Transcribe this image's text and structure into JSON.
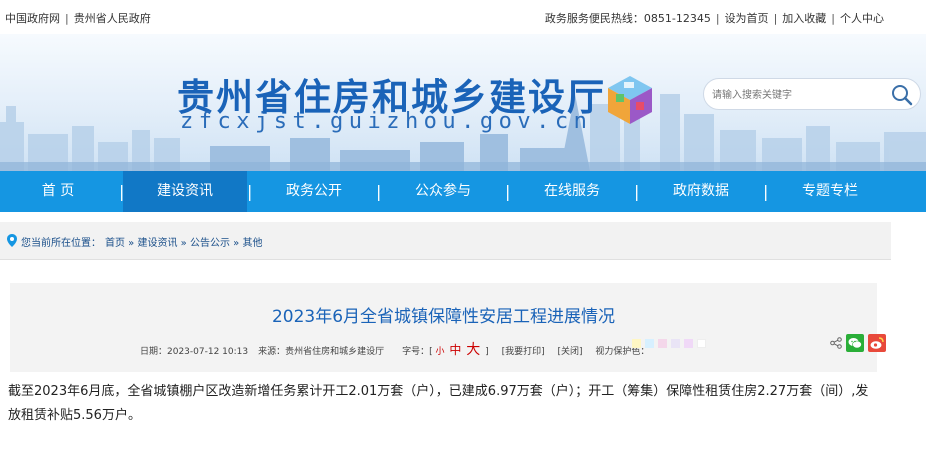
{
  "topbar": {
    "left_links": [
      "中国政府网",
      "贵州省人民政府"
    ],
    "right_items": [
      "政务服务便民热线：0851-12345",
      "设为首页",
      "加入收藏",
      "个人中心"
    ]
  },
  "header": {
    "title": "贵州省住房和城乡建设厅",
    "domain": "zfcxjst.guizhou.gov.cn",
    "search_placeholder": "请输入搜索关键字"
  },
  "nav": {
    "items": [
      "首 页",
      "建设资讯",
      "政务公开",
      "公众参与",
      "在线服务",
      "政府数据",
      "专题专栏"
    ],
    "active_index": 1
  },
  "breadcrumb": {
    "label": "您当前所在位置：",
    "path": [
      "首页",
      "建设资讯",
      "公告公示",
      "其他"
    ]
  },
  "article": {
    "title": "2023年6月全省城镇保障性安居工程进展情况",
    "date": "日期：2023-07-12 10:13",
    "source": "来源：贵州省住房和城乡建设厅",
    "font_size_label": "字号：[",
    "font_small": "小",
    "font_medium": "中",
    "font_large": "大",
    "font_close": "]",
    "print": "[我要打印]",
    "close": "[关闭]",
    "vision_label": "视力保护色：",
    "swatch_colors": [
      "#fff7c4",
      "#d7f0ff",
      "#f4d7ea",
      "#e9e4f6",
      "#f0d9f7",
      "#ffffff"
    ],
    "body": "截至2023年6月底，全省城镇棚户区改造新增任务累计开工2.01万套（户），已建成6.97万套（户）；开工（筹集）保障性租赁住房2.27万套（间）,发放租赁补贴5.56万户。"
  },
  "colors": {
    "nav_bg": "#1596e2",
    "nav_active": "#1178c6",
    "title_blue": "#1a63b8"
  }
}
